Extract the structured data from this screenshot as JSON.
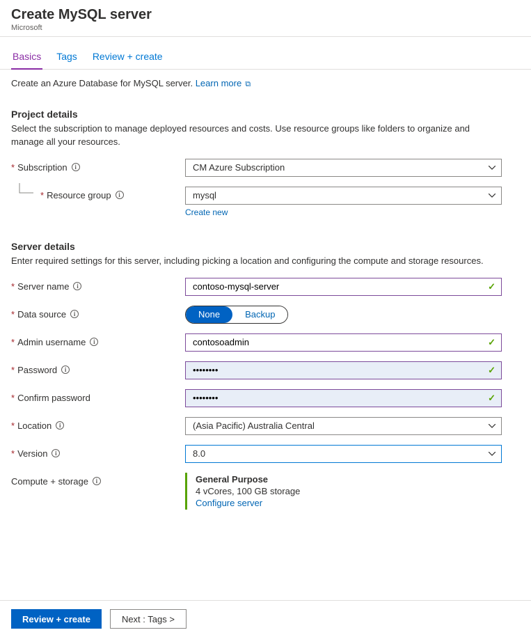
{
  "header": {
    "title": "Create MySQL server",
    "subtitle": "Microsoft"
  },
  "tabs": [
    {
      "id": "basics",
      "label": "Basics",
      "active": true
    },
    {
      "id": "tags",
      "label": "Tags",
      "active": false
    },
    {
      "id": "review",
      "label": "Review + create",
      "active": false
    }
  ],
  "intro": {
    "prefix": "Create an Azure Database for MySQL server. ",
    "link_label": "Learn more"
  },
  "project_details": {
    "title": "Project details",
    "desc": "Select the subscription to manage deployed resources and costs. Use resource groups like folders to organize and manage all your resources.",
    "subscription": {
      "label": "Subscription",
      "value": "CM Azure Subscription"
    },
    "resource_group": {
      "label": "Resource group",
      "value": "mysql",
      "create_link": "Create new"
    }
  },
  "server_details": {
    "title": "Server details",
    "desc": "Enter required settings for this server, including picking a location and configuring the compute and storage resources.",
    "server_name": {
      "label": "Server name",
      "value": "contoso-mysql-server"
    },
    "data_source": {
      "label": "Data source",
      "options": [
        "None",
        "Backup"
      ],
      "selected": "None"
    },
    "admin_username": {
      "label": "Admin username",
      "value": "contosoadmin"
    },
    "password": {
      "label": "Password",
      "value": "••••••••"
    },
    "confirm_password": {
      "label": "Confirm password",
      "value": "••••••••"
    },
    "location": {
      "label": "Location",
      "value": "(Asia Pacific) Australia Central"
    },
    "version": {
      "label": "Version",
      "value": "8.0"
    },
    "compute": {
      "label": "Compute + storage",
      "tier": "General Purpose",
      "spec": "4 vCores, 100 GB storage",
      "configure_link": "Configure server"
    }
  },
  "footer": {
    "primary": "Review + create",
    "secondary": "Next : Tags >"
  }
}
